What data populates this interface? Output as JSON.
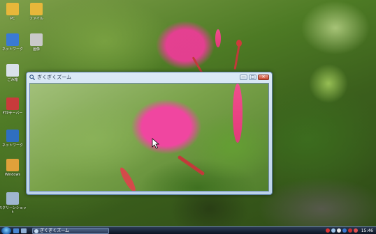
{
  "desktop": {
    "icons": [
      {
        "label": "PC",
        "icon": "computer-icon",
        "color": "#e7b73a"
      },
      {
        "label": "ファイル",
        "icon": "folder-icon",
        "color": "#e7b73a"
      },
      {
        "label": "ネットワーク",
        "icon": "network-icon",
        "color": "#3a7ad4"
      },
      {
        "label": "画像",
        "icon": "image-file-icon",
        "color": "#c9c9c9"
      },
      {
        "label": "ごみ箱",
        "icon": "recycle-bin-icon",
        "color": "#d9e1ea"
      },
      {
        "label": "FTPサーバー",
        "icon": "ftp-icon",
        "color": "#c83b3b"
      },
      {
        "label": "ネットワーク",
        "icon": "network-share-icon",
        "color": "#2f6fc0"
      },
      {
        "label": "Windows",
        "icon": "windows-icon",
        "color": "#e0a13a"
      },
      {
        "label": "スクリーンショット",
        "icon": "screenshot-icon",
        "color": "#9fb6cf"
      }
    ]
  },
  "magnifier_window": {
    "title": "ぎくぎくズーム",
    "controls": {
      "minimize": "—",
      "maximize": "□",
      "close": "✕"
    }
  },
  "taskbar": {
    "start_icon": "windows-start-orb",
    "task_button_label": "ぎくぎくズーム",
    "clock": "15:46",
    "colors": {
      "accent": "#1d5ea9"
    }
  }
}
